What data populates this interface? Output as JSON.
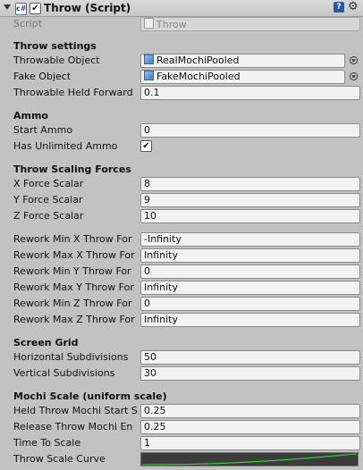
{
  "component": {
    "title": "Throw (Script)",
    "enabled_mark": "✔",
    "script_label": "Script",
    "script_value": "Throw"
  },
  "sections": {
    "throw_settings": "Throw settings",
    "ammo": "Ammo",
    "scaling": "Throw Scaling Forces",
    "screen_grid": "Screen Grid",
    "mochi_scale": "Mochi Scale (uniform scale)"
  },
  "fields": {
    "throwable_object": {
      "label": "Throwable Object",
      "value": "RealMochiPooled"
    },
    "fake_object": {
      "label": "Fake Object",
      "value": "FakeMochiPooled"
    },
    "throwable_held_forward": {
      "label": "Throwable Held Forward",
      "value": "0.1"
    },
    "start_ammo": {
      "label": "Start Ammo",
      "value": "0"
    },
    "has_unlimited_ammo": {
      "label": "Has Unlimited Ammo",
      "checked": true,
      "mark": "✔"
    },
    "x_force": {
      "label": "X Force Scalar",
      "value": "8"
    },
    "y_force": {
      "label": "Y Force Scalar",
      "value": "9"
    },
    "z_force": {
      "label": "Z Force Scalar",
      "value": "10"
    },
    "rework_min_x": {
      "label": "Rework Min X Throw For",
      "value": "-Infinity"
    },
    "rework_max_x": {
      "label": "Rework Max X Throw For",
      "value": "Infinity"
    },
    "rework_min_y": {
      "label": "Rework Min Y Throw For",
      "value": "0"
    },
    "rework_max_y": {
      "label": "Rework Max Y Throw For",
      "value": "Infinity"
    },
    "rework_min_z": {
      "label": "Rework Min Z Throw For",
      "value": "0"
    },
    "rework_max_z": {
      "label": "Rework Max Z Throw For",
      "value": "Infinity"
    },
    "horizontal_subdivisions": {
      "label": "Horizontal Subdivisions",
      "value": "50"
    },
    "vertical_subdivisions": {
      "label": "Vertical Subdivisions",
      "value": "30"
    },
    "held_throw_mochi_start": {
      "label": "Held Throw Mochi Start S",
      "value": "0.25"
    },
    "release_throw_mochi_end": {
      "label": "Release Throw Mochi En",
      "value": "0.25"
    },
    "time_to_scale": {
      "label": "Time To Scale",
      "value": "1"
    },
    "throw_scale_curve": {
      "label": "Throw Scale Curve",
      "curve_color": "#3ad63a"
    }
  },
  "colors": {
    "panel": "#c2c2c2",
    "field": "#f2f2f2",
    "curve_bg": "#3b3b3b",
    "curve": "#3ad63a"
  },
  "icons": {
    "fold": "foldout-triangle-icon",
    "script": "script-icon",
    "help": "help-book-icon",
    "settings": "gear-icon",
    "object": "prefab-cube-icon",
    "picker": "object-picker-icon"
  }
}
